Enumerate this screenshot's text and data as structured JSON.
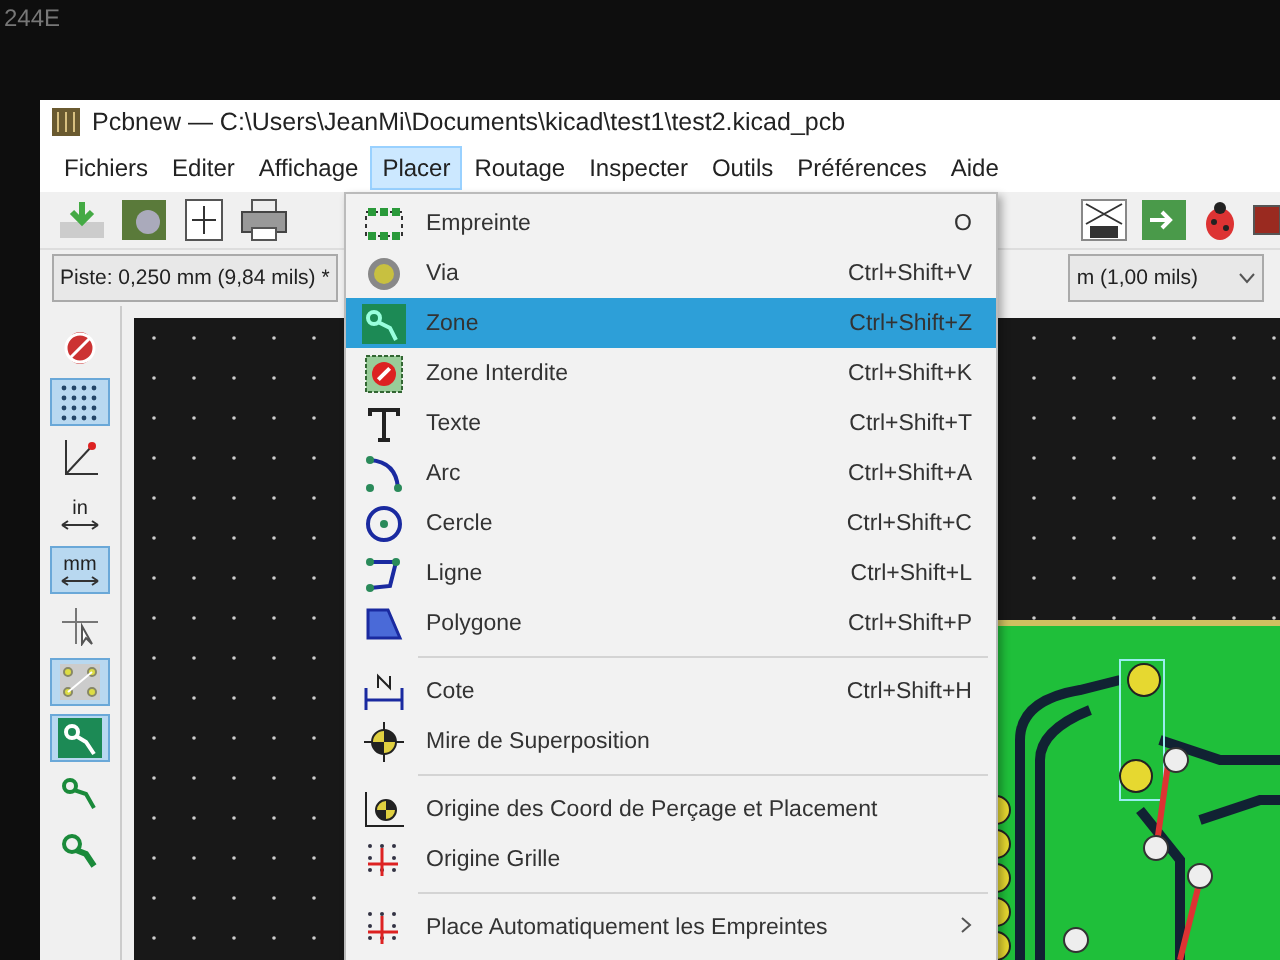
{
  "bezel_label": "244E",
  "window": {
    "title": "Pcbnew — C:\\Users\\JeanMi\\Documents\\kicad\\test1\\test2.kicad_pcb"
  },
  "menubar": [
    {
      "label": "Fichiers",
      "selected": false
    },
    {
      "label": "Editer",
      "selected": false
    },
    {
      "label": "Affichage",
      "selected": false
    },
    {
      "label": "Placer",
      "selected": true
    },
    {
      "label": "Routage",
      "selected": false
    },
    {
      "label": "Inspecter",
      "selected": false
    },
    {
      "label": "Outils",
      "selected": false
    },
    {
      "label": "Préférences",
      "selected": false
    },
    {
      "label": "Aide",
      "selected": false
    }
  ],
  "track_field": {
    "value": "Piste: 0,250 mm (9,84 mils) *"
  },
  "grid_field": {
    "value": "m (1,00 mils)"
  },
  "left_toolbar": [
    {
      "on": false
    },
    {
      "on": true
    },
    {
      "on": false
    },
    {
      "label": "in",
      "on": false
    },
    {
      "label": "mm",
      "on": true
    },
    {
      "on": false
    },
    {
      "on": true
    },
    {
      "on": true
    },
    {
      "on": false
    },
    {
      "on": false
    }
  ],
  "menu": {
    "groups": [
      [
        {
          "label": "Empreinte",
          "shortcut": "O",
          "selected": false
        },
        {
          "label": "Via",
          "shortcut": "Ctrl+Shift+V",
          "selected": false
        },
        {
          "label": "Zone",
          "shortcut": "Ctrl+Shift+Z",
          "selected": true
        },
        {
          "label": "Zone Interdite",
          "shortcut": "Ctrl+Shift+K",
          "selected": false
        },
        {
          "label": "Texte",
          "shortcut": "Ctrl+Shift+T",
          "selected": false
        },
        {
          "label": "Arc",
          "shortcut": "Ctrl+Shift+A",
          "selected": false
        },
        {
          "label": "Cercle",
          "shortcut": "Ctrl+Shift+C",
          "selected": false
        },
        {
          "label": "Ligne",
          "shortcut": "Ctrl+Shift+L",
          "selected": false
        },
        {
          "label": "Polygone",
          "shortcut": "Ctrl+Shift+P",
          "selected": false
        }
      ],
      [
        {
          "label": "Cote",
          "shortcut": "Ctrl+Shift+H",
          "selected": false
        },
        {
          "label": "Mire de Superposition",
          "selected": false
        }
      ],
      [
        {
          "label": "Origine des Coord de Perçage et Placement",
          "selected": false
        },
        {
          "label": "Origine Grille",
          "selected": false
        }
      ],
      [
        {
          "label": "Place Automatiquement les Empreintes",
          "selected": false,
          "submenu": true
        }
      ]
    ]
  }
}
